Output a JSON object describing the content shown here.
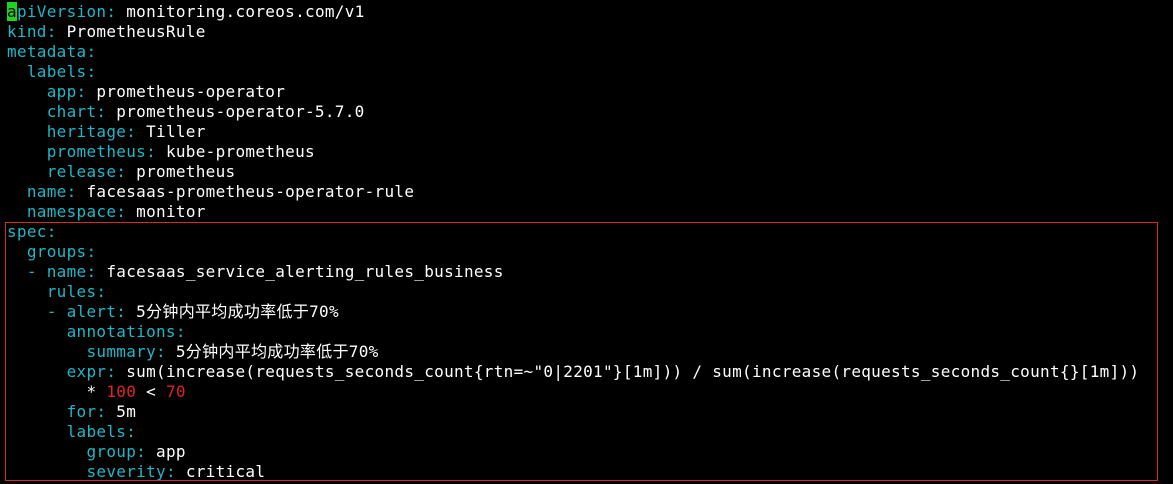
{
  "colors": {
    "background": "#000000",
    "key": "#1fb7c8",
    "value": "#ffffff",
    "number": "#e02424",
    "cursor": "#21d321",
    "highlight_border": "#d42a2a"
  },
  "editor": {
    "cursor_char": "a",
    "lines": {
      "api_version_rest": "piVersion",
      "api_version_value": "monitoring.coreos.com/v1",
      "kind_key": "kind",
      "kind_value": "PrometheusRule",
      "metadata_key": "metadata",
      "labels_key": "labels",
      "app_key": "app",
      "app_value": "prometheus-operator",
      "chart_key": "chart",
      "chart_value": "prometheus-operator-5.7.0",
      "heritage_key": "heritage",
      "heritage_value": "Tiller",
      "prometheus_key": "prometheus",
      "prometheus_value": "kube-prometheus",
      "release_key": "release",
      "release_value": "prometheus",
      "name_key": "name",
      "name_value": "facesaas-prometheus-operator-rule",
      "namespace_key": "namespace",
      "namespace_value": "monitor",
      "spec_key": "spec",
      "groups_key": "groups",
      "group_name_key": "name",
      "group_name_value": "facesaas_service_alerting_rules_business",
      "rules_key": "rules",
      "alert_key": "alert",
      "alert_value": "5分钟内平均成功率低于70%",
      "annotations_key": "annotations",
      "summary_key": "summary",
      "summary_value": "5分钟内平均成功率低于70%",
      "expr_key": "expr",
      "expr_value": "sum(increase(requests_seconds_count{rtn=~\"0|2201\"}[1m])) / sum(increase(requests_seconds_count{}[1m]))",
      "expr_cont_op": "*",
      "expr_cont_num1": "100",
      "expr_cont_cmp": "<",
      "expr_cont_num2": "70",
      "for_key": "for",
      "for_value": "5m",
      "rule_labels_key": "labels",
      "group_key": "group",
      "group_value": "app",
      "severity_key": "severity",
      "severity_value": "critical"
    }
  }
}
